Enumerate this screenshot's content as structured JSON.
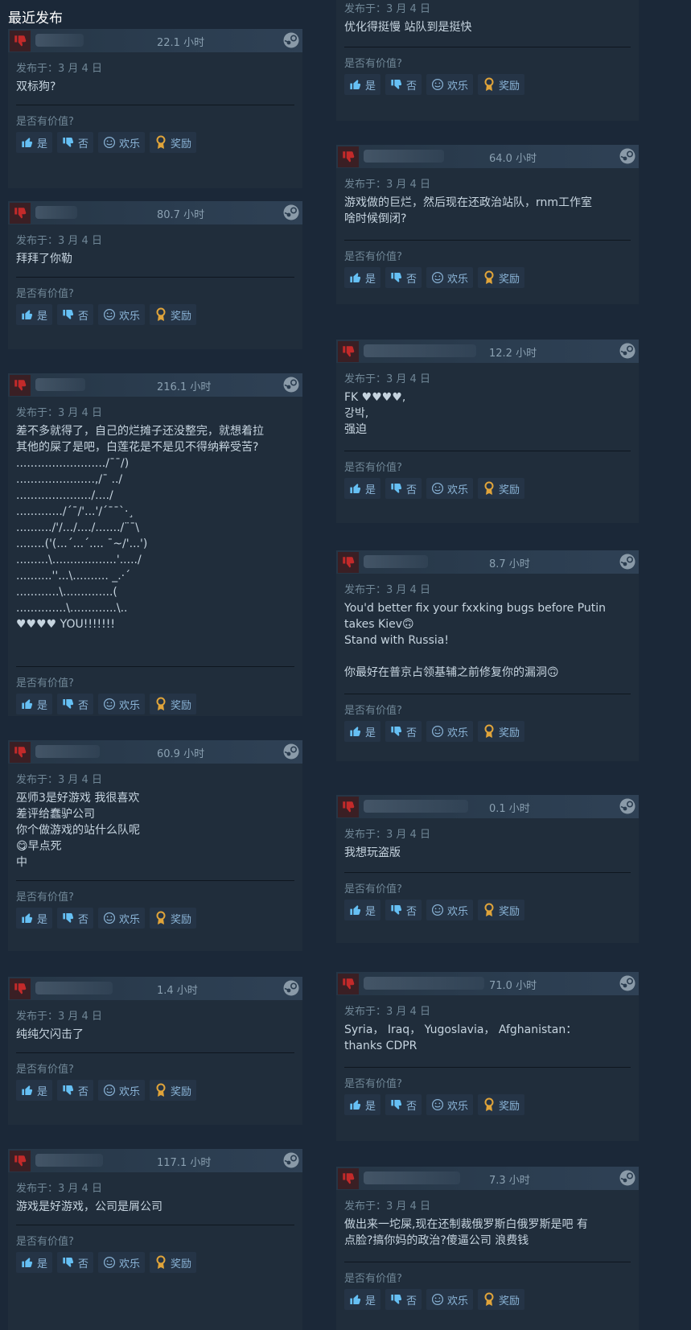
{
  "section_title": "最近发布",
  "labels": {
    "helpful_question": "是否有价值?",
    "yes": "是",
    "no": "否",
    "funny": "欢乐",
    "award": "奖励"
  },
  "colors": {
    "background": "#1b2838",
    "card": "#202d3b",
    "thumb_down": "#c32a2a",
    "award_gold": "#e0a43a",
    "button_text": "#8bb5d8"
  },
  "reviews_left": [
    {
      "hours": "22.1 小时",
      "date": "发布于：3 月 4 日",
      "text": "双标狗?"
    },
    {
      "hours": "80.7 小时",
      "date": "发布于：3 月 4 日",
      "text": "拜拜了你勒"
    },
    {
      "hours": "216.1 小时",
      "date": "发布于：3 月 4 日",
      "text": "差不多就得了，自己的烂摊子还没整完，就想着拉\n其他的屎了是吧，白莲花是不是见不得纳粹受苦?\n........................./¯¯/)\n......................,/¯ ../\n...................../..../\n............./´¯/'...'/´¯¯`·¸\n........../'/.../..../......./¨¯\\\n........('(...´...´.... ¯~/'...')\n.........\\..................'...../\n..........''...\\.......... _.·´\n............\\..............(\n..............\\.............\\..\n♥♥♥♥ YOU!!!!!!!"
    },
    {
      "hours": "60.9 小时",
      "date": "发布于：3 月 4 日",
      "text": "巫师3是好游戏 我很喜欢\n差评给蠢驴公司\n你个做游戏的站什么队呢\n😋早点死\n中"
    },
    {
      "hours": "1.4 小时",
      "date": "发布于：3 月 4 日",
      "text": "纯纯欠闪击了"
    },
    {
      "hours": "117.1 小时",
      "date": "发布于：3 月 4 日",
      "text": "游戏是好游戏，公司是屑公司"
    }
  ],
  "reviews_right": [
    {
      "hours": "",
      "date": "发布于：3 月 4 日",
      "text": "优化得挺慢 站队到是挺快"
    },
    {
      "hours": "64.0 小时",
      "date": "发布于：3 月 4 日",
      "text": "游戏做的巨烂，然后现在还政治站队，rnm工作室\n啥时候倒闭?"
    },
    {
      "hours": "12.2 小时",
      "date": "发布于：3 月 4 日",
      "text": "FK ♥♥♥♥,\n강박,\n强迫"
    },
    {
      "hours": "8.7 小时",
      "date": "发布于：3 月 4 日",
      "text": "You'd better fix your fxxking bugs before Putin\ntakes Kiev🙃\nStand with Russia!\n\n你最好在普京占领基辅之前修复你的漏洞🙃"
    },
    {
      "hours": "0.1 小时",
      "date": "发布于：3 月 4 日",
      "text": "我想玩盗版"
    },
    {
      "hours": "71.0 小时",
      "date": "发布于：3 月 4 日",
      "text": "Syria， Iraq， Yugoslavia， Afghanistan：\nthanks CDPR"
    },
    {
      "hours": "7.3 小时",
      "date": "发布于：3 月 4 日",
      "text": "做出来一坨屎,现在还制裁俄罗斯白俄罗斯是吧 有\n点脸?搞你妈的政治?傻逼公司 浪费钱"
    }
  ]
}
